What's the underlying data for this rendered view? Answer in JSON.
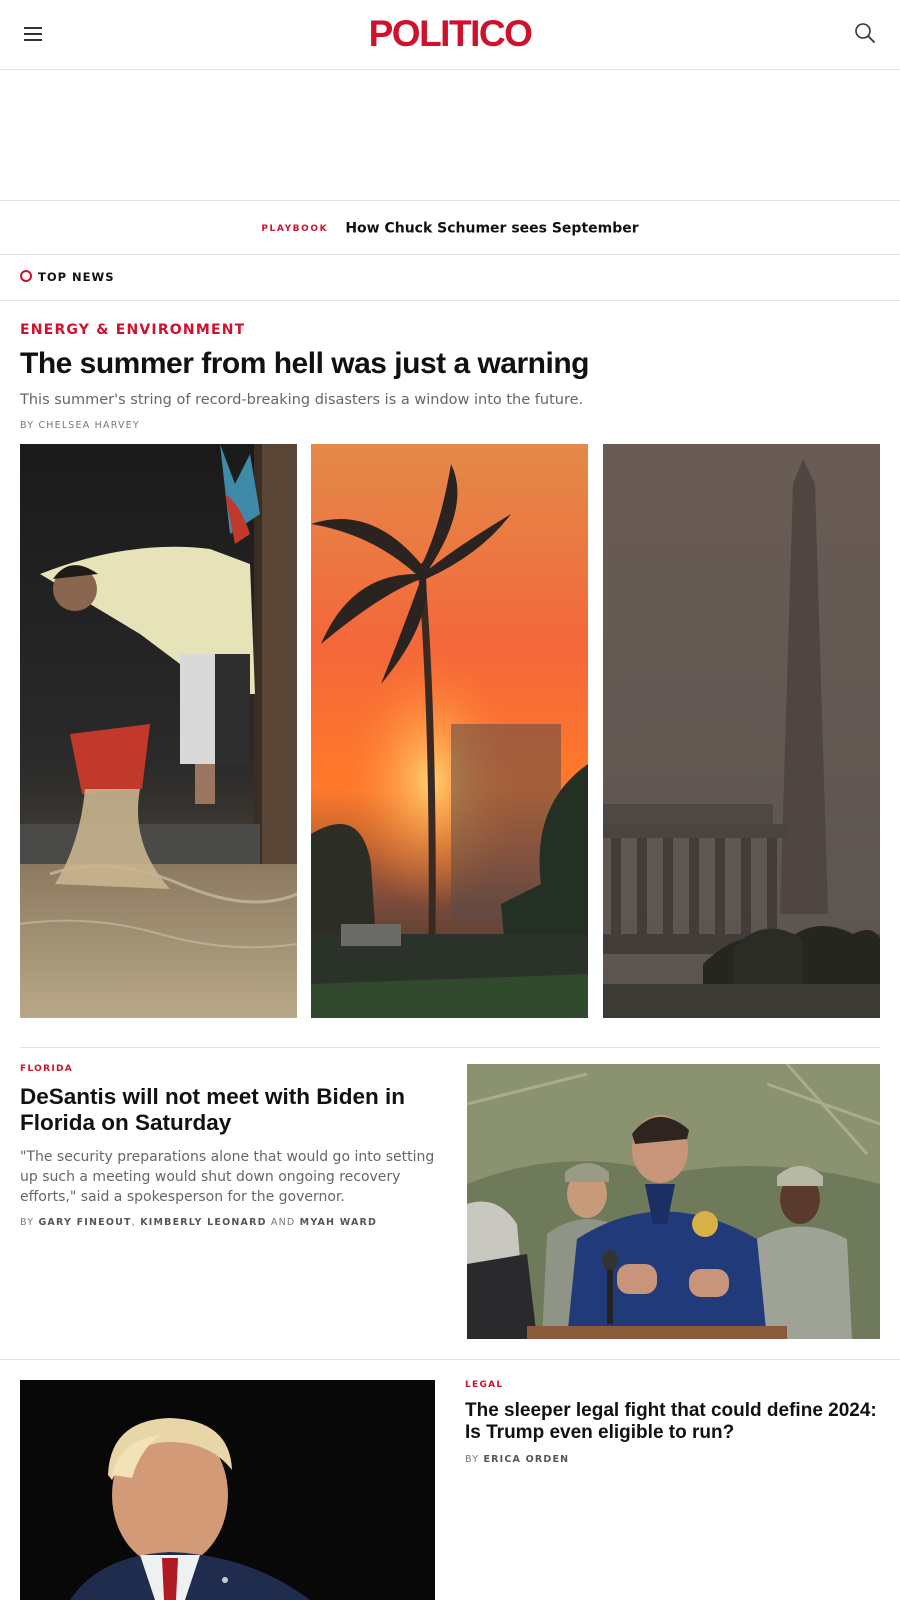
{
  "header": {
    "logo_text": "POLITICO",
    "brand_color": "#d1102c"
  },
  "playbook": {
    "tag": "PLAYBOOK",
    "headline": "How Chuck Schumer sees September"
  },
  "top_news": {
    "label": "TOP NEWS"
  },
  "lead_story": {
    "kicker": "ENERGY & ENVIRONMENT",
    "headline": "The summer from hell was just a warning",
    "dek": "This summer's string of record-breaking disasters is a window into the future.",
    "byline_prefix": "BY",
    "author": "CHELSEA HARVEY",
    "images": [
      "flood-photo",
      "wildfire-photo",
      "smoke-monument-photo"
    ]
  },
  "story_2": {
    "kicker": "FLORIDA",
    "headline": "DeSantis will not meet with Biden in Florida on Saturday",
    "dek": "\"The security preparations alone that would go into setting up such a meeting would shut down ongoing recovery efforts,\" said a spokesperson for the governor.",
    "byline_prefix": "BY",
    "authors": [
      "GARY FINEOUT",
      "KIMBERLY LEONARD",
      "MYAH WARD"
    ],
    "sep_comma": ",",
    "sep_and": "AND"
  },
  "story_3": {
    "kicker": "LEGAL",
    "headline": "The sleeper legal fight that could define 2024: Is Trump even eligible to run?",
    "byline_prefix": "BY",
    "author": "ERICA ORDEN"
  }
}
